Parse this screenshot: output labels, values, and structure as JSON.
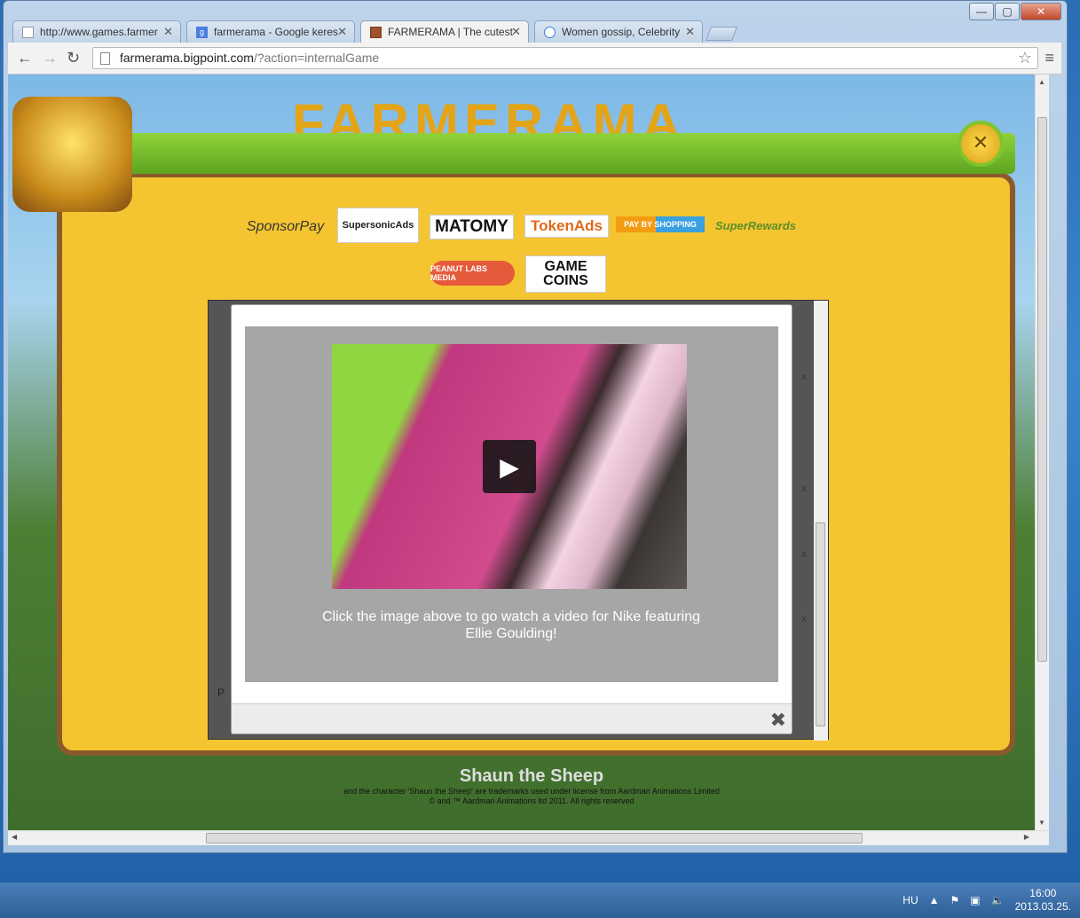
{
  "window": {
    "controls": {
      "minimize": "—",
      "maximize": "▢",
      "close": "✕"
    }
  },
  "tabs": [
    {
      "label": "http://www.games.farmer",
      "favicon": "page-icon"
    },
    {
      "label": "farmerama - Google keres",
      "favicon": "google-icon"
    },
    {
      "label": "FARMERAMA | The cutest",
      "favicon": "farmerama-icon"
    },
    {
      "label": "Women gossip, Celebrity",
      "favicon": "loading-icon"
    }
  ],
  "toolbar": {
    "back": "←",
    "forward": "→",
    "reload": "↻",
    "url_host": "farmerama.bigpoint.com",
    "url_path": "/?action=internalGame",
    "star": "☆",
    "menu": "≡"
  },
  "game": {
    "logo_text": "FARMERAMA",
    "close_symbol": "✕",
    "sponsors": {
      "sponsorpay": "SponsorPay",
      "supersonic": "SupersonicAds",
      "matomy": "MATOMY",
      "tokenads": "TokenAds",
      "paybyshopping": "PAY BY SHOPPING",
      "superrewards": "SuperRewards",
      "peanutlabs": "PEANUT LABS MEDIA",
      "gamecoins": "GAME COINS"
    },
    "offer_close_marks": [
      "x",
      "x",
      "x",
      "x"
    ],
    "offer_partial_text": "P"
  },
  "modal": {
    "play_symbol": "▶",
    "caption": "Click the image above to go watch a video for Nike featuring Ellie Goulding!",
    "close_symbol": "✖"
  },
  "footer": {
    "brand": "Shaun the Sheep",
    "line1": "and the character 'Shaun the Sheep' are trademarks used under license from Aardman Animations Limited",
    "line2": "© and ™ Aardman Animations ltd 2011. All rights reserved"
  },
  "taskbar": {
    "language": "HU",
    "time": "16:00",
    "date": "2013.03.25."
  },
  "colors": {
    "panel_yellow": "#f5c531",
    "header_green": "#6fb82a",
    "modal_gray": "#a6a6a6"
  }
}
